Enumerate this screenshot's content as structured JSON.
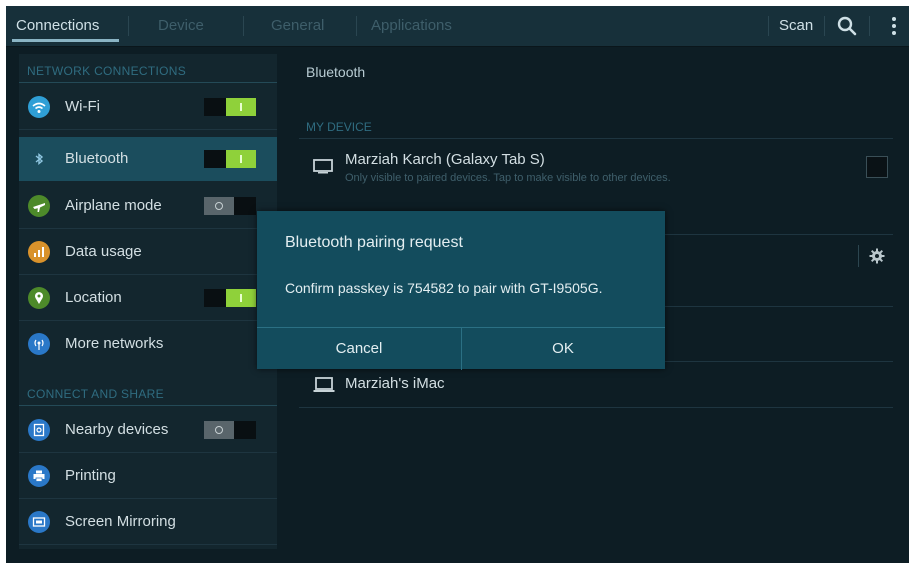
{
  "tabs": [
    {
      "label": "Connections",
      "active": true
    },
    {
      "label": "Device",
      "active": false
    },
    {
      "label": "General",
      "active": false
    },
    {
      "label": "Applications",
      "active": false
    }
  ],
  "actions": {
    "scan": "Scan",
    "search_icon": "search-icon",
    "overflow_icon": "overflow-menu-icon"
  },
  "left": {
    "network_header": "NETWORK CONNECTIONS",
    "connect_header": "CONNECT AND SHARE",
    "items": [
      {
        "label": "Wi-Fi",
        "icon": "wifi-icon",
        "color": "#2f9fd6",
        "toggle": "on"
      },
      {
        "label": "Bluetooth",
        "icon": "bluetooth-icon",
        "color": "#2f9fd6",
        "toggle": "on",
        "selected": true
      },
      {
        "label": "Airplane mode",
        "icon": "airplane-icon",
        "color": "#4d8a2a",
        "toggle": "off"
      },
      {
        "label": "Data usage",
        "icon": "data-usage-icon",
        "color": "#d9922b"
      },
      {
        "label": "Location",
        "icon": "location-icon",
        "color": "#4d8a2a",
        "toggle": "on"
      },
      {
        "label": "More networks",
        "icon": "more-networks-icon",
        "color": "#2a78c8"
      },
      {
        "label": "Nearby devices",
        "icon": "nearby-devices-icon",
        "color": "#2a78c8",
        "toggle": "off"
      },
      {
        "label": "Printing",
        "icon": "printer-icon",
        "color": "#2a78c8"
      },
      {
        "label": "Screen Mirroring",
        "icon": "screen-mirroring-icon",
        "color": "#2a78c8"
      }
    ]
  },
  "right": {
    "title": "Bluetooth",
    "my_device_header": "MY DEVICE",
    "my_device_name": "Marziah Karch (Galaxy Tab S)",
    "my_device_sub": "Only visible to paired devices. Tap to make visible to other devices.",
    "other_device_name": "Marziah's iMac"
  },
  "dialog": {
    "title": "Bluetooth pairing request",
    "message": "Confirm passkey is 754582 to pair with GT-I9505G.",
    "cancel": "Cancel",
    "ok": "OK"
  }
}
